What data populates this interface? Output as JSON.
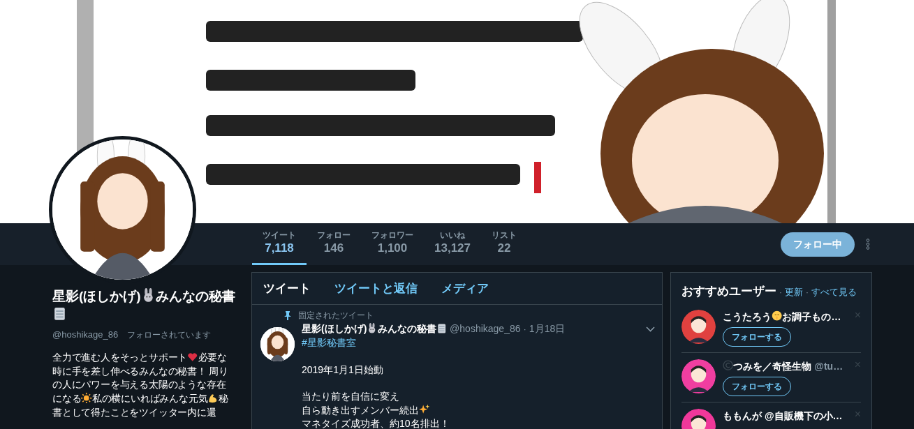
{
  "banner": {
    "kind": "picture"
  },
  "avatar": {
    "kind": "picture"
  },
  "stats": [
    {
      "label": "ツイート",
      "value": "7,118",
      "selected": true
    },
    {
      "label": "フォロー",
      "value": "146",
      "selected": false
    },
    {
      "label": "フォロワー",
      "value": "1,100",
      "selected": false
    },
    {
      "label": "いいね",
      "value": "13,127",
      "selected": false
    },
    {
      "label": "リスト",
      "value": "22",
      "selected": false
    }
  ],
  "follow_button": "フォロー中",
  "profile": {
    "name": [
      {
        "kind": "text",
        "text": "星影(ほしかげ)"
      },
      {
        "kind": "rabbit"
      },
      {
        "kind": "text",
        "text": "みんなの秘書"
      },
      {
        "kind": "notepad"
      }
    ],
    "handle": "@hoshikage_86",
    "follows_you": "フォローされています",
    "bio": [
      {
        "kind": "text",
        "text": "全力で進む人をそっとサポート"
      },
      {
        "kind": "heart"
      },
      {
        "kind": "text",
        "text": "必要な時に手を差し伸べるみんなの秘書！ 周りの人にパワーを与える太陽のような存在になる"
      },
      {
        "kind": "sun"
      },
      {
        "kind": "text",
        "text": "私の横にいればみんな元気"
      },
      {
        "kind": "muscle"
      },
      {
        "kind": "text",
        "text": "秘書として得たことをツイッター内に還"
      }
    ]
  },
  "timeline": {
    "tabs": [
      {
        "label": "ツイート",
        "selected": true
      },
      {
        "label": "ツイートと返信",
        "selected": false
      },
      {
        "label": "メディア",
        "selected": false
      }
    ],
    "pinned_label": "固定されたツイート",
    "tweet": {
      "avatar": {
        "kind": "picture"
      },
      "name": [
        {
          "kind": "text",
          "text": "星影(ほしかげ)"
        },
        {
          "kind": "rabbit"
        },
        {
          "kind": "text",
          "text": "みんなの秘書"
        },
        {
          "kind": "notepad"
        }
      ],
      "handle": "@hoshikage_86",
      "separator": "·",
      "date": "1月18日",
      "paragraphs": [
        [
          [
            {
              "kind": "link",
              "text": "#星影秘書室"
            }
          ]
        ],
        [
          [
            {
              "kind": "text",
              "text": "2019年1月1日始動"
            }
          ]
        ],
        [
          [
            {
              "kind": "text",
              "text": "当たり前を自信に変え"
            }
          ],
          [
            {
              "kind": "text",
              "text": "自ら動き出すメンバー続出"
            },
            {
              "kind": "sparkles"
            }
          ],
          [
            {
              "kind": "text",
              "text": "マネタイズ成功者、約10名排出！"
            }
          ]
        ]
      ]
    }
  },
  "suggestions": {
    "title": "おすすめユーザー",
    "links": [
      {
        "separator": "·",
        "label": "更新"
      },
      {
        "separator": "·",
        "label": "すべて見る"
      }
    ],
    "users": [
      {
        "color": "#e0413f",
        "name": [
          {
            "kind": "text",
            "text": "こうたろう"
          },
          {
            "kind": "shush"
          },
          {
            "kind": "text",
            "text": "お調子もの…"
          }
        ],
        "button": "フォローする",
        "dismiss": "×"
      },
      {
        "color": "#f03ea0",
        "name": [
          {
            "kind": "copyright"
          },
          {
            "kind": "text",
            "text": "つみを／奇怪生物"
          },
          {
            "kind": "handle",
            "text": " @tu…"
          }
        ],
        "button": "フォローする",
        "dismiss": "×"
      },
      {
        "color": "#f0389a",
        "name": [
          {
            "kind": "text",
            "text": "ももんが @自販機下の小…"
          }
        ],
        "dismiss": "×"
      }
    ]
  }
}
